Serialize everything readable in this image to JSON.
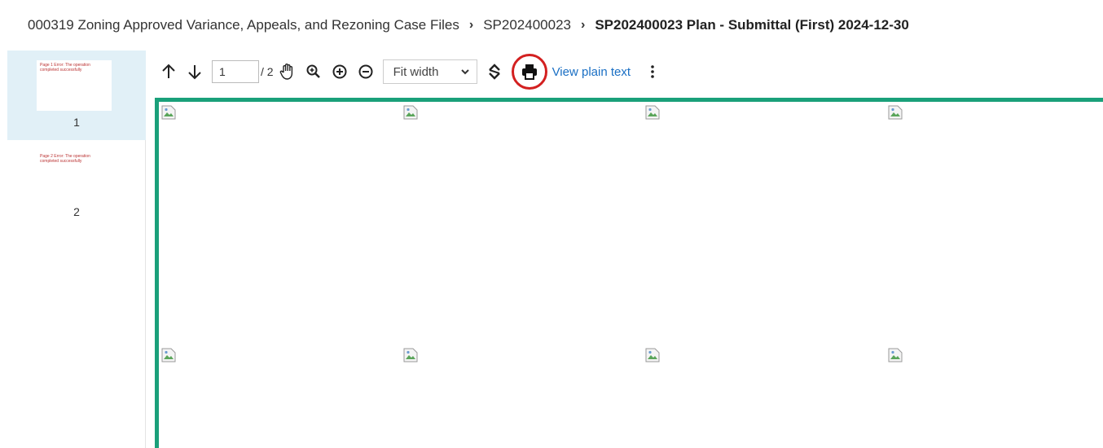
{
  "breadcrumb": {
    "items": [
      "000319 Zoning Approved Variance, Appeals, and Rezoning Case Files",
      "SP202400023"
    ],
    "current": "SP202400023 Plan - Submittal (First) 2024-12-30",
    "separator": "›"
  },
  "sidebar": {
    "thumbnails": [
      {
        "page_label": "1",
        "preview_text": "Page 1 Error: The operation completed successfully",
        "active": true
      },
      {
        "page_label": "2",
        "preview_text": "Page 2 Error: The operation completed successfully",
        "active": false
      }
    ]
  },
  "toolbar": {
    "current_page": "1",
    "total_pages": "/ 2",
    "zoom": "Fit width",
    "view_plain_text": "View plain text",
    "icons": [
      "arrow-up-icon",
      "arrow-down-icon",
      "hand-pan-icon",
      "zoom-search-icon",
      "zoom-in-icon",
      "zoom-out-icon",
      "chevron-down-icon",
      "rotate-icon",
      "printer-icon",
      "more-vertical-icon"
    ]
  },
  "colors": {
    "document_border": "#1aa07a",
    "print_highlight": "#d32020",
    "link": "#1a6fc4",
    "active_thumbnail_bg": "#e1f0f7"
  },
  "document": {
    "broken_image_count": 8
  }
}
